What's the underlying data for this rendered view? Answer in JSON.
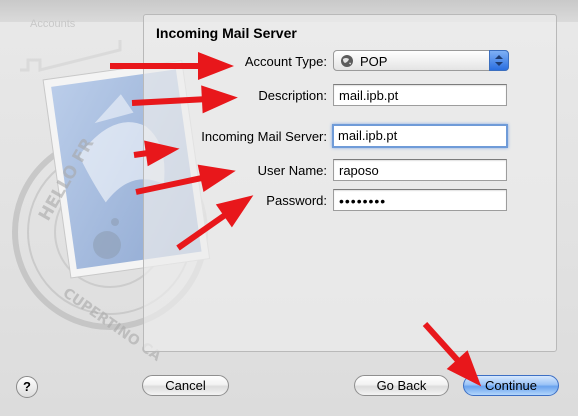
{
  "window": {
    "sidebar_ghost": "Accounts",
    "panel_title": "Incoming Mail Server"
  },
  "form": {
    "account_type": {
      "label": "Account Type:",
      "value": "POP",
      "icon": "globe-icon"
    },
    "description": {
      "label": "Description:",
      "value": "mail.ipb.pt"
    },
    "incoming_server": {
      "label": "Incoming Mail Server:",
      "value": "mail.ipb.pt"
    },
    "user_name": {
      "label": "User Name:",
      "value": "raposo"
    },
    "password": {
      "label": "Password:",
      "value": "••••••••"
    }
  },
  "buttons": {
    "help": "?",
    "cancel": "Cancel",
    "go_back": "Go Back",
    "continue": "Continue"
  },
  "stamp": {
    "text_top": "HELLO FR",
    "text_bottom": "CUPERTINO CA"
  },
  "colors": {
    "annotation_arrow": "#e8171b",
    "focus_ring": "#6f9bd8",
    "default_button": "#6aa3ee"
  }
}
